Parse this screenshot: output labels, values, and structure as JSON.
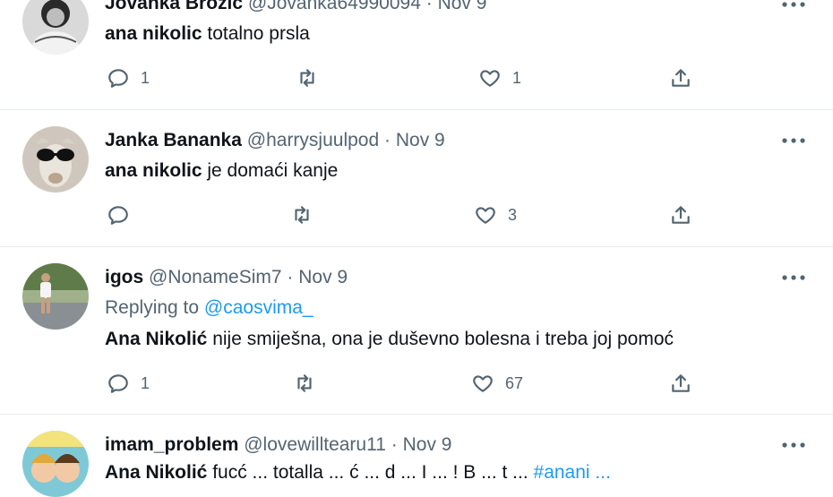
{
  "colors": {
    "text": "#0f1419",
    "secondary": "#536471",
    "link": "#1d9bf0",
    "divider": "#e6ecf0"
  },
  "tweets": [
    {
      "name": "Jovanka Brozic",
      "handle": "@Jovanka64990094",
      "date": "Nov 9",
      "separator": "·",
      "bold_lead": "ana nikolic",
      "text": " totalno prsla",
      "reply_count": "1",
      "retweet_count": "",
      "like_count": "1"
    },
    {
      "name": "Janka Bananka",
      "handle": "@harrysjuulpod",
      "date": "Nov 9",
      "separator": "·",
      "bold_lead": "ana nikolic",
      "text": " je domaći kanje",
      "reply_count": "",
      "retweet_count": "",
      "like_count": "3"
    },
    {
      "name": "igos",
      "handle": "@NonameSim7",
      "date": "Nov 9",
      "separator": "·",
      "replying_label": "Replying to",
      "replying_handle": "@caosvima_",
      "bold_lead": "Ana Nikolić",
      "text": " nije smiješna, ona je duševno bolesna i treba joj pomoć",
      "reply_count": "1",
      "retweet_count": "",
      "like_count": "67"
    },
    {
      "name": "imam_problem",
      "handle": "@lovewilltearu11",
      "date": "Nov 9",
      "separator": "·",
      "bold_lead": "Ana Nikolić",
      "text": " fucć ... totalla ... ć ... d ... I ... ! B ... t ...",
      "link_text": "#anani ...",
      "reply_count": "",
      "retweet_count": "",
      "like_count": ""
    }
  ]
}
